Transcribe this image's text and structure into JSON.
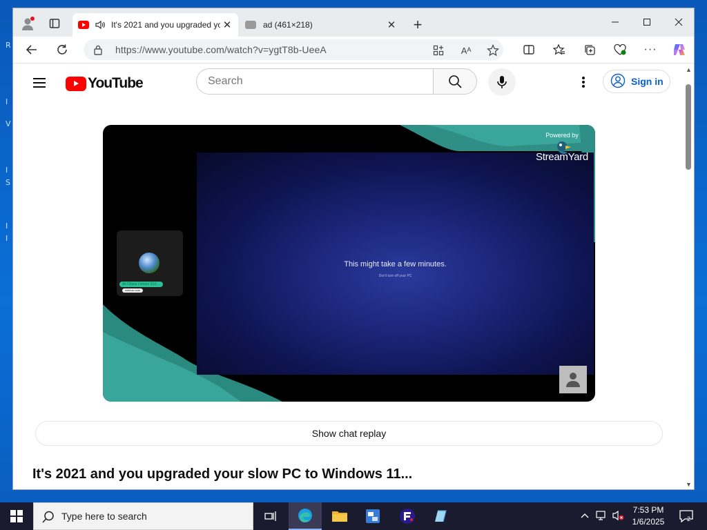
{
  "desktop": {
    "letters": [
      "R",
      "I",
      "V",
      "I",
      "S",
      "I",
      "I"
    ]
  },
  "browser": {
    "tabs": [
      {
        "title": "It's 2021 and you upgraded your slow PC to Windows 11...",
        "active": true
      },
      {
        "title": "ad (461×218)",
        "active": false
      }
    ],
    "url": "https://www.youtube.com/watch?v=ygtT8b-UeeA"
  },
  "youtube": {
    "logo_text": "YouTube",
    "search_placeholder": "Search",
    "signin_label": "Sign in",
    "video": {
      "message": "This might take a few minutes.",
      "sub_message": "Don't turn off your PC",
      "powered_by": "Powered by",
      "brand": "StreamYard",
      "cam_name": "Ali Chaos Lenovo S10 ...",
      "cam_sub": "sidebar note"
    },
    "chat_replay_label": "Show chat replay",
    "title": "It's 2021 and you upgraded your slow PC to Windows 11..."
  },
  "taskbar": {
    "search_placeholder": "Type here to search",
    "time": "7:53 PM",
    "date": "1/6/2025",
    "notification_count": "2"
  }
}
